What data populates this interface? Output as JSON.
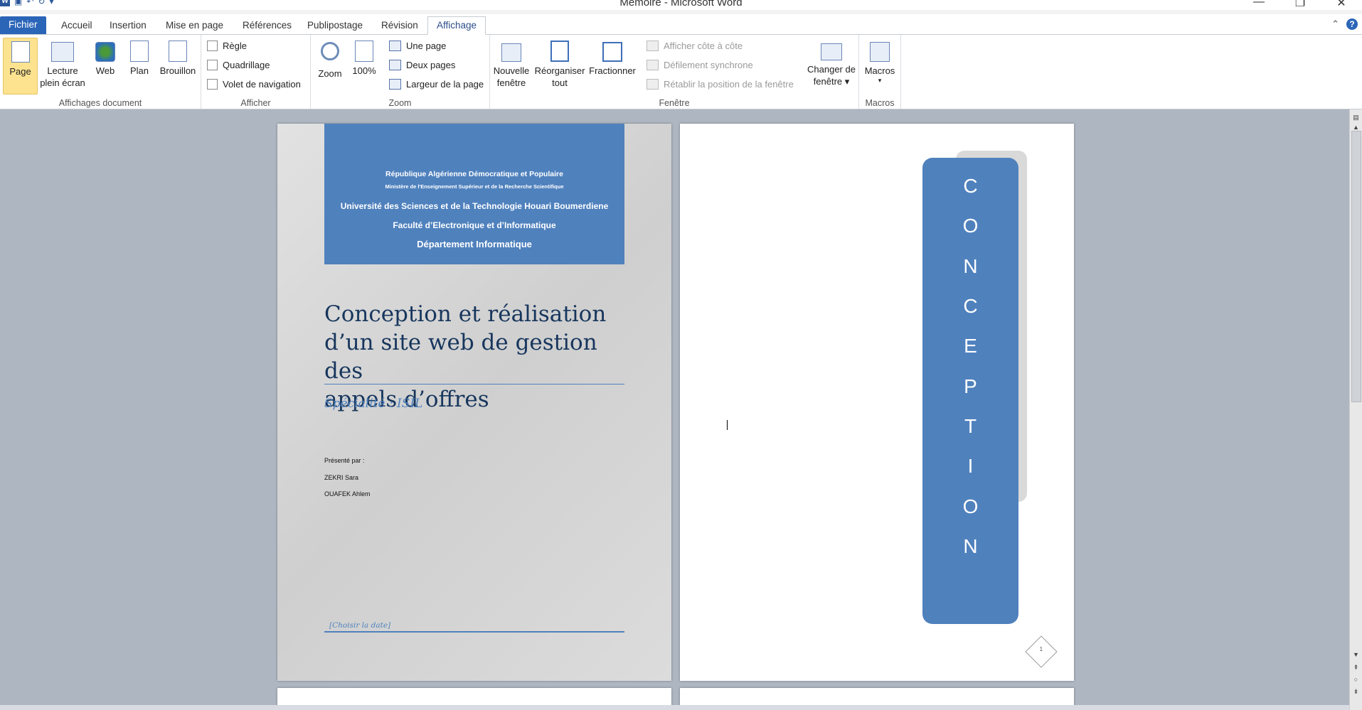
{
  "window": {
    "title": "Memoire - Microsoft Word",
    "app_icon": "W",
    "controls": [
      "—",
      "❐",
      "✕"
    ]
  },
  "tabs": [
    {
      "label": "Fichier"
    },
    {
      "label": "Accueil"
    },
    {
      "label": "Insertion"
    },
    {
      "label": "Mise en page"
    },
    {
      "label": "Références"
    },
    {
      "label": "Publipostage"
    },
    {
      "label": "Révision"
    },
    {
      "label": "Affichage"
    }
  ],
  "help_label": "?",
  "ribbon": {
    "affichages_document": {
      "label": "Affichages document",
      "page": "Page",
      "lecture_1": "Lecture",
      "lecture_2": "plein écran",
      "web": "Web",
      "plan": "Plan",
      "brouillon": "Brouillon"
    },
    "afficher": {
      "label": "Afficher",
      "regle": "Règle",
      "quadrillage": "Quadrillage",
      "volet": "Volet de navigation"
    },
    "zoom": {
      "label": "Zoom",
      "zoom": "Zoom",
      "cent": "100%",
      "une_page": "Une page",
      "deux_pages": "Deux pages",
      "largeur": "Largeur de la page"
    },
    "fenetre": {
      "label": "Fenêtre",
      "nouvelle_1": "Nouvelle",
      "nouvelle_2": "fenêtre",
      "reorg_1": "Réorganiser",
      "reorg_2": "tout",
      "fractionner": "Fractionner",
      "cote": "Afficher côte à côte",
      "defilement": "Défilement synchrone",
      "retablir": "Rétablir la position de la fenêtre",
      "changer_1": "Changer de",
      "changer_2": "fenêtre ▾"
    },
    "macros": {
      "label": "Macros",
      "macros": "Macros",
      "arrow": "▾"
    }
  },
  "document": {
    "cover": {
      "line1": "République Algérienne Démocratique et Populaire",
      "line2": "Ministère de l'Enseignement  Supérieur et de la Recherche Scientifique",
      "line3": "Université des Sciences et de la Technologie Houari Boumerdiene",
      "line4": "Faculté d’Electronique et d’Informatique",
      "line5": "Département Informatique",
      "title_1": "Conception et réalisation",
      "title_2": "d’un site web de gestion des",
      "title_3": "appels d’offres",
      "subtitle": "Spécialité : ISIL",
      "presente": "Présenté par :",
      "author1": "ZEKRI Sara",
      "author2": "OUAFEK Ahlem",
      "date": "[Choisir la date]"
    },
    "page2": {
      "letters": [
        "C",
        "O",
        "N",
        "C",
        "E",
        "P",
        "T",
        "I",
        "O",
        "N"
      ],
      "page_number": "1"
    }
  }
}
